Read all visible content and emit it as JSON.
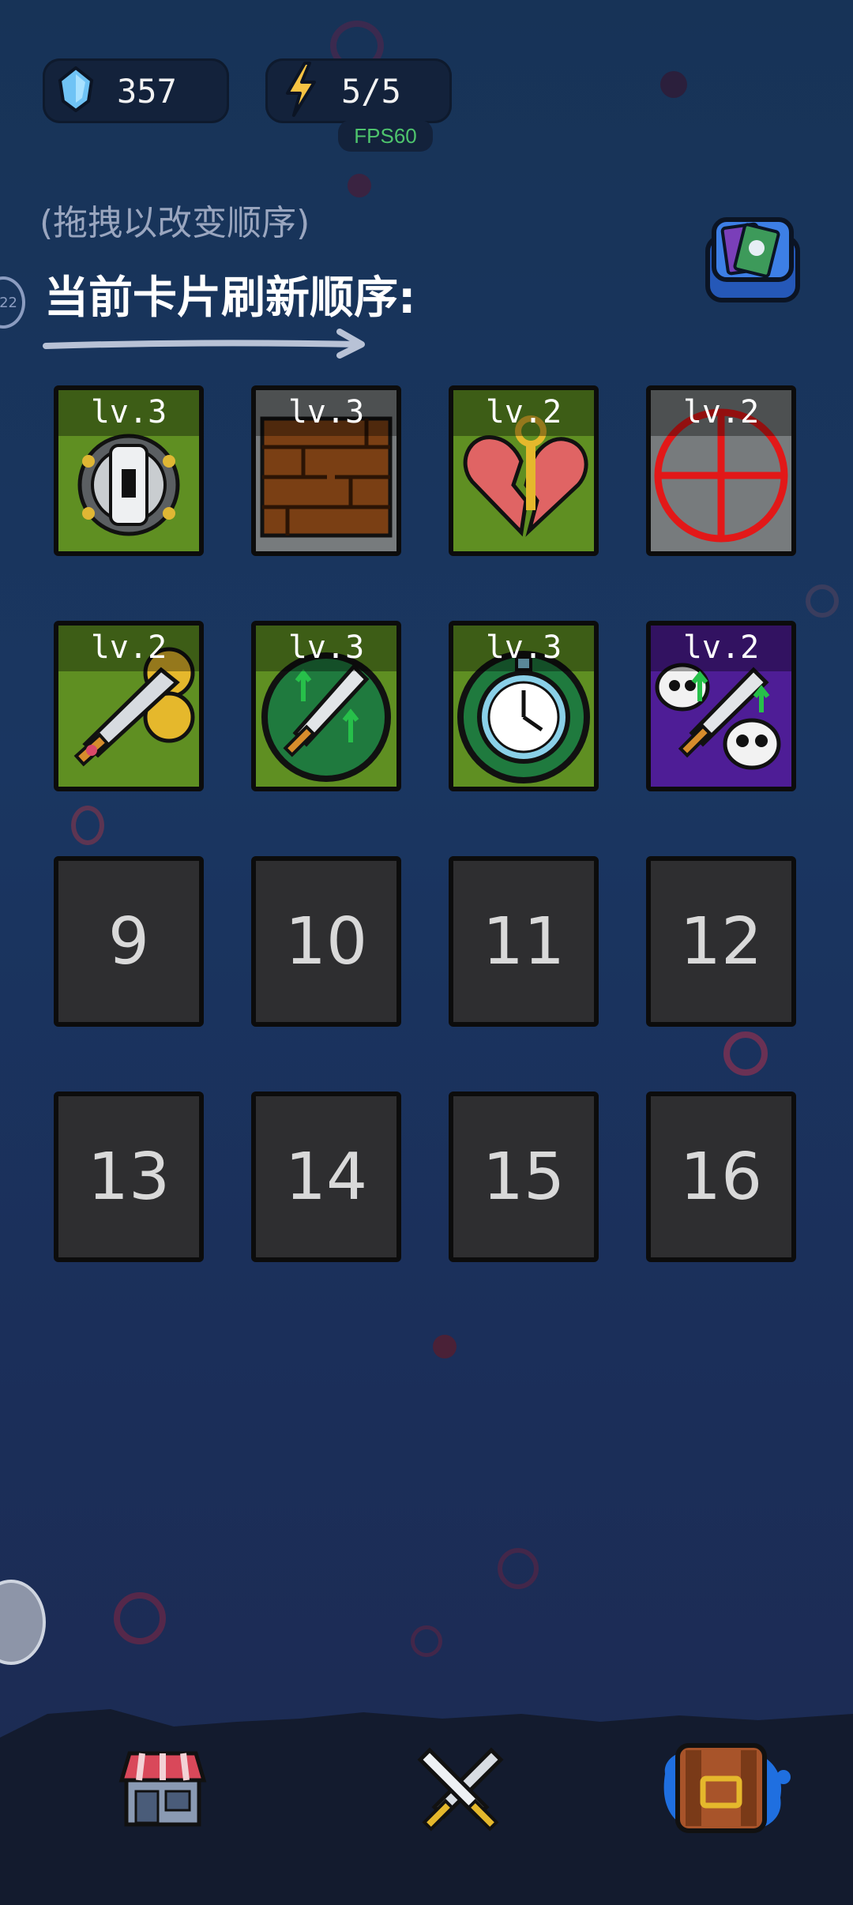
{
  "stats": {
    "gems": "357",
    "energy": "5/5",
    "fps": "FPS60"
  },
  "hint": "(拖拽以改变顺序)",
  "title": "当前卡片刷新顺序:",
  "side_badge": "22",
  "cards": [
    {
      "level": "lv.3",
      "icon": "turret-machine-icon",
      "bg": "green"
    },
    {
      "level": "lv.3",
      "icon": "wooden-wall-icon",
      "bg": "grey"
    },
    {
      "level": "lv.2",
      "icon": "broken-heart-key-icon",
      "bg": "green"
    },
    {
      "level": "lv.2",
      "icon": "red-crosshair-icon",
      "bg": "grey"
    },
    {
      "level": "lv.2",
      "icon": "sword-coins-icon",
      "bg": "green"
    },
    {
      "level": "lv.3",
      "icon": "sword-upgrade-icon",
      "bg": "green"
    },
    {
      "level": "lv.3",
      "icon": "stopwatch-icon",
      "bg": "green"
    },
    {
      "level": "lv.2",
      "icon": "sword-skulls-icon",
      "bg": "purple"
    }
  ],
  "empty_slots": [
    "9",
    "10",
    "11",
    "12",
    "13",
    "14",
    "15",
    "16"
  ],
  "nav": [
    {
      "icon": "shop-icon"
    },
    {
      "icon": "crossed-swords-icon"
    },
    {
      "icon": "backpack-icon",
      "active": true
    }
  ],
  "colors": {
    "card_green": "#5f8f22",
    "card_grey": "#777b7d",
    "card_purple": "#4e1d96",
    "fps_green": "#4ec46d",
    "nav_active": "#1f6fe0"
  }
}
